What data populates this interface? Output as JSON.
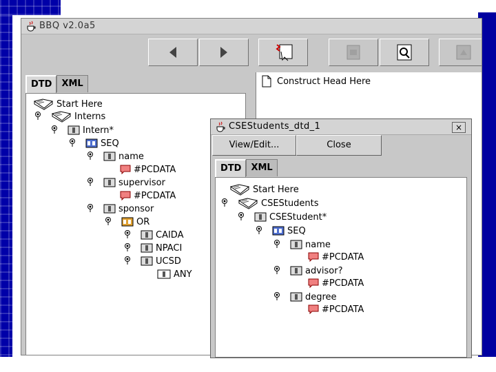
{
  "app": {
    "title": "BBQ v2.0a5"
  },
  "toolbar": {
    "buttons": [
      {
        "icon": "arrow-left-icon"
      },
      {
        "icon": "arrow-right-icon"
      },
      {
        "icon": "new-construct-icon"
      },
      {
        "icon": "disabled-action-icon"
      },
      {
        "icon": "document-search-icon"
      },
      {
        "icon": "disabled-execute-icon"
      }
    ]
  },
  "left_tabs": [
    "DTD",
    "XML"
  ],
  "left_tree": [
    {
      "label": "Start Here",
      "icon": "book-icon"
    },
    {
      "label": "Interns",
      "icon": "book-icon"
    },
    {
      "label": "Intern*",
      "icon": "element-icon"
    },
    {
      "label": "SEQ",
      "icon": "seq-icon"
    },
    {
      "label": "name",
      "icon": "element-icon"
    },
    {
      "label": "#PCDATA",
      "icon": "pcdata-icon"
    },
    {
      "label": "supervisor",
      "icon": "element-icon"
    },
    {
      "label": "#PCDATA",
      "icon": "pcdata-icon"
    },
    {
      "label": "sponsor",
      "icon": "element-icon"
    },
    {
      "label": "OR",
      "icon": "or-icon"
    },
    {
      "label": "CAIDA",
      "icon": "element-icon"
    },
    {
      "label": "NPACI",
      "icon": "element-icon"
    },
    {
      "label": "UCSD",
      "icon": "element-icon"
    },
    {
      "label": "ANY",
      "icon": "any-icon"
    }
  ],
  "right_pane": {
    "construct_label": "Construct Head Here"
  },
  "dialog": {
    "title": "CSEStudents_dtd_1",
    "close_glyph": "×",
    "view_edit_label": "View/Edit...",
    "close_label": "Close",
    "tabs": [
      "DTD",
      "XML"
    ],
    "tree": [
      {
        "label": "Start Here"
      },
      {
        "label": "CSEStudents"
      },
      {
        "label": "CSEStudent*"
      },
      {
        "label": "SEQ"
      },
      {
        "label": "name"
      },
      {
        "label": "#PCDATA"
      },
      {
        "label": "advisor?"
      },
      {
        "label": "#PCDATA"
      },
      {
        "label": "degree"
      },
      {
        "label": "#PCDATA"
      }
    ]
  },
  "colors": {
    "slide_blue": "#0000a8",
    "window_gray": "#c8c8c8",
    "pcdata_red": "#e07070",
    "seq_blue": "#2040c0",
    "or_orange": "#d09020"
  }
}
